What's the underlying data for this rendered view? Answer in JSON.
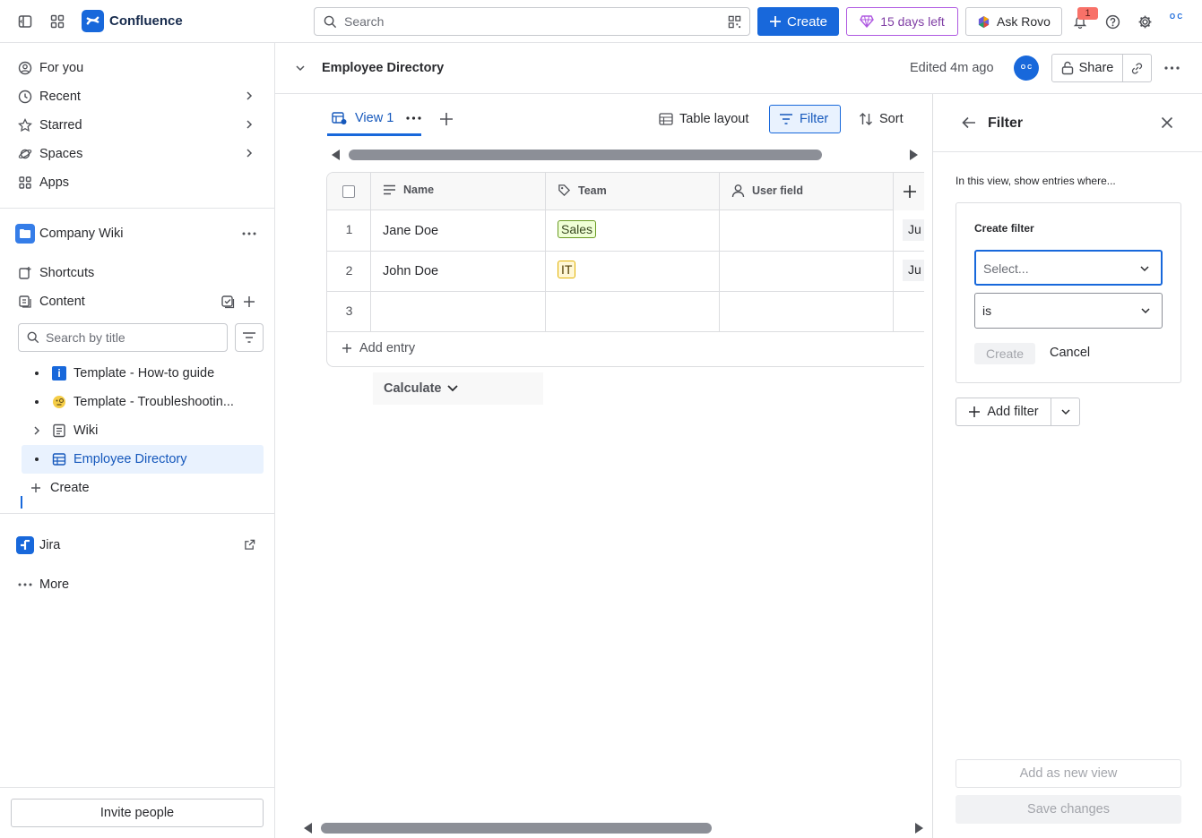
{
  "topbar": {
    "brand": "Confluence",
    "search_placeholder": "Search",
    "create_label": "Create",
    "trial_label": "15 days left",
    "rovo_label": "Ask Rovo",
    "notification_count": "1",
    "avatar_initials": "O C"
  },
  "sidebar": {
    "nav": [
      {
        "label": "For you",
        "icon": "user-circle-icon"
      },
      {
        "label": "Recent",
        "icon": "clock-icon"
      },
      {
        "label": "Starred",
        "icon": "star-icon"
      },
      {
        "label": "Spaces",
        "icon": "planet-icon"
      },
      {
        "label": "Apps",
        "icon": "apps-icon"
      }
    ],
    "space_name": "Company Wiki",
    "shortcuts_label": "Shortcuts",
    "content_label": "Content",
    "search_placeholder": "Search by title",
    "tree": [
      {
        "label": "Template - How-to guide",
        "icon": "info-icon"
      },
      {
        "label": "Template - Troubleshootin...",
        "icon": "face-icon"
      },
      {
        "label": "Wiki",
        "icon": "page-icon"
      },
      {
        "label": "Employee Directory",
        "icon": "database-icon",
        "active": true
      }
    ],
    "create_label": "Create",
    "jira_label": "Jira",
    "more_label": "More",
    "invite_label": "Invite people"
  },
  "page": {
    "title": "Employee Directory",
    "edited": "Edited 4m ago",
    "avatar_initials": "O C",
    "share_label": "Share"
  },
  "database": {
    "view_tab": "View 1",
    "table_layout_label": "Table layout",
    "filter_label": "Filter",
    "sort_label": "Sort",
    "columns": [
      "Name",
      "Team",
      "User field"
    ],
    "rows": [
      {
        "num": "1",
        "name": "Jane Doe",
        "team": "Sales",
        "extra": "Ju"
      },
      {
        "num": "2",
        "name": "John Doe",
        "team": "IT",
        "extra": "Ju"
      },
      {
        "num": "3",
        "name": "",
        "team": "",
        "extra": ""
      }
    ],
    "add_entry_label": "Add entry",
    "calculate_label": "Calculate"
  },
  "filter_panel": {
    "title": "Filter",
    "description": "In this view, show entries where...",
    "create_filter_label": "Create filter",
    "field_placeholder": "Select...",
    "operator_value": "is",
    "create_label": "Create",
    "cancel_label": "Cancel",
    "add_filter_label": "Add filter",
    "add_as_view_label": "Add as new view",
    "save_label": "Save changes"
  },
  "colors": {
    "brand_blue": "#1868db",
    "trial_purple": "#af59e1",
    "tag_sales_bg": "#efffd6",
    "tag_it_bg": "#fff7d6"
  }
}
